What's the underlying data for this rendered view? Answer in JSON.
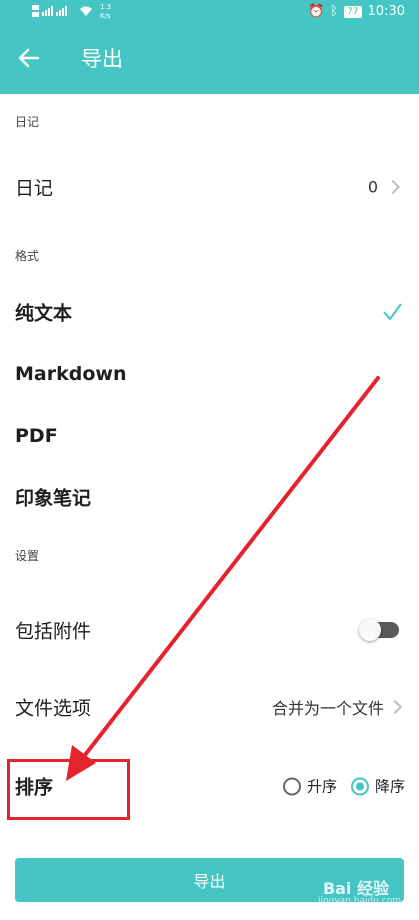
{
  "status_bar": {
    "net_speed": "1.3\nK/s",
    "battery": "77",
    "time": "10:30"
  },
  "app_bar": {
    "title": "导出"
  },
  "sections": {
    "diary": "日记",
    "format": "格式",
    "settings": "设置"
  },
  "diary_row": {
    "label": "日记",
    "count": "0"
  },
  "formats": [
    {
      "label": "纯文本",
      "selected": true
    },
    {
      "label": "Markdown",
      "selected": false
    },
    {
      "label": "PDF",
      "selected": false
    },
    {
      "label": "印象笔记",
      "selected": false
    }
  ],
  "settings": {
    "include_attachments": {
      "label": "包括附件",
      "enabled": false
    },
    "file_options": {
      "label": "文件选项",
      "value": "合并为一个文件"
    },
    "sort": {
      "label": "排序",
      "asc": "升序",
      "desc": "降序",
      "selected": "降序"
    }
  },
  "export_button": "导出",
  "watermark": {
    "brand": "Bai 经验",
    "url": "jingyan.baidu.com"
  },
  "colors": {
    "accent": "#45c5c4",
    "annotation": "#e5232d"
  }
}
